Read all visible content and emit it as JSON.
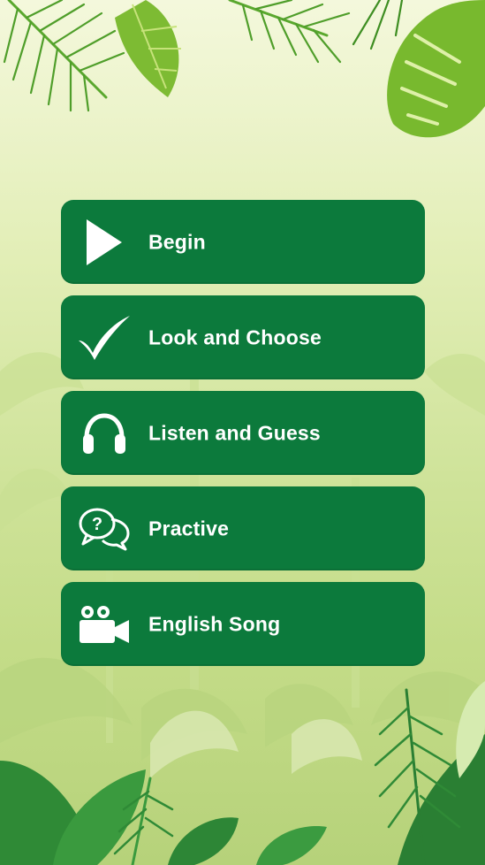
{
  "menu": {
    "items": [
      {
        "label": "Begin",
        "icon": "play-icon"
      },
      {
        "label": "Look and Choose",
        "icon": "checkmark-icon"
      },
      {
        "label": "Listen and Guess",
        "icon": "headphones-icon"
      },
      {
        "label": "Practive",
        "icon": "question-chat-icon"
      },
      {
        "label": "English Song",
        "icon": "video-camera-icon"
      }
    ]
  },
  "colors": {
    "button": "#0c7a3c",
    "button_text": "#ffffff",
    "background_top": "#f4f8dc",
    "background_bottom": "#b6d27a",
    "leaf_light": "#9ccc3c",
    "leaf_dark": "#2e8b3a"
  }
}
